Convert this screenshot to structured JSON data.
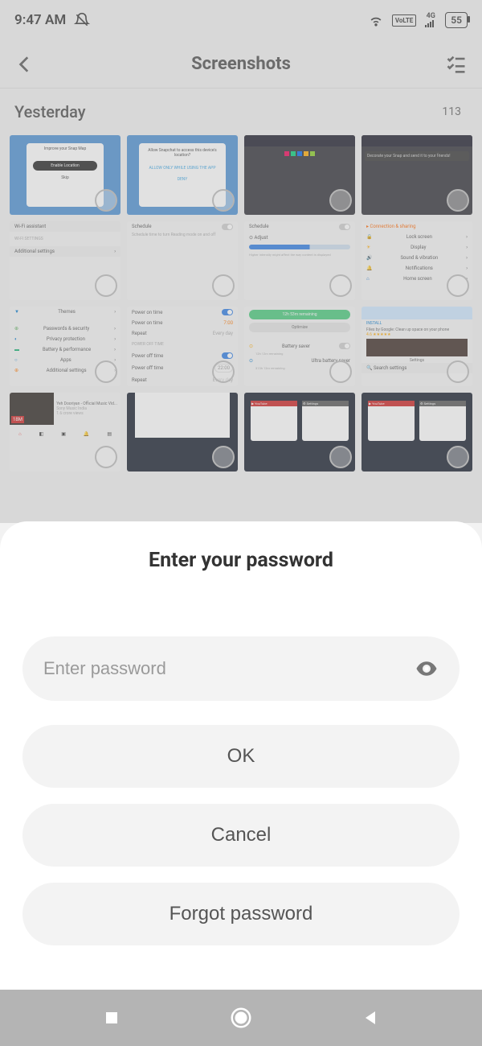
{
  "status": {
    "time": "9:47 AM",
    "dnd": "dnd-icon",
    "wifi": "wifi-icon",
    "volte": "VoLTE",
    "network": "4G",
    "battery_pct": "55"
  },
  "header": {
    "title": "Screenshots"
  },
  "section": {
    "title": "Yesterday",
    "count": "113"
  },
  "dialog": {
    "title": "Enter your password",
    "placeholder": "Enter password",
    "ok": "OK",
    "cancel": "Cancel",
    "forgot": "Forgot password"
  }
}
